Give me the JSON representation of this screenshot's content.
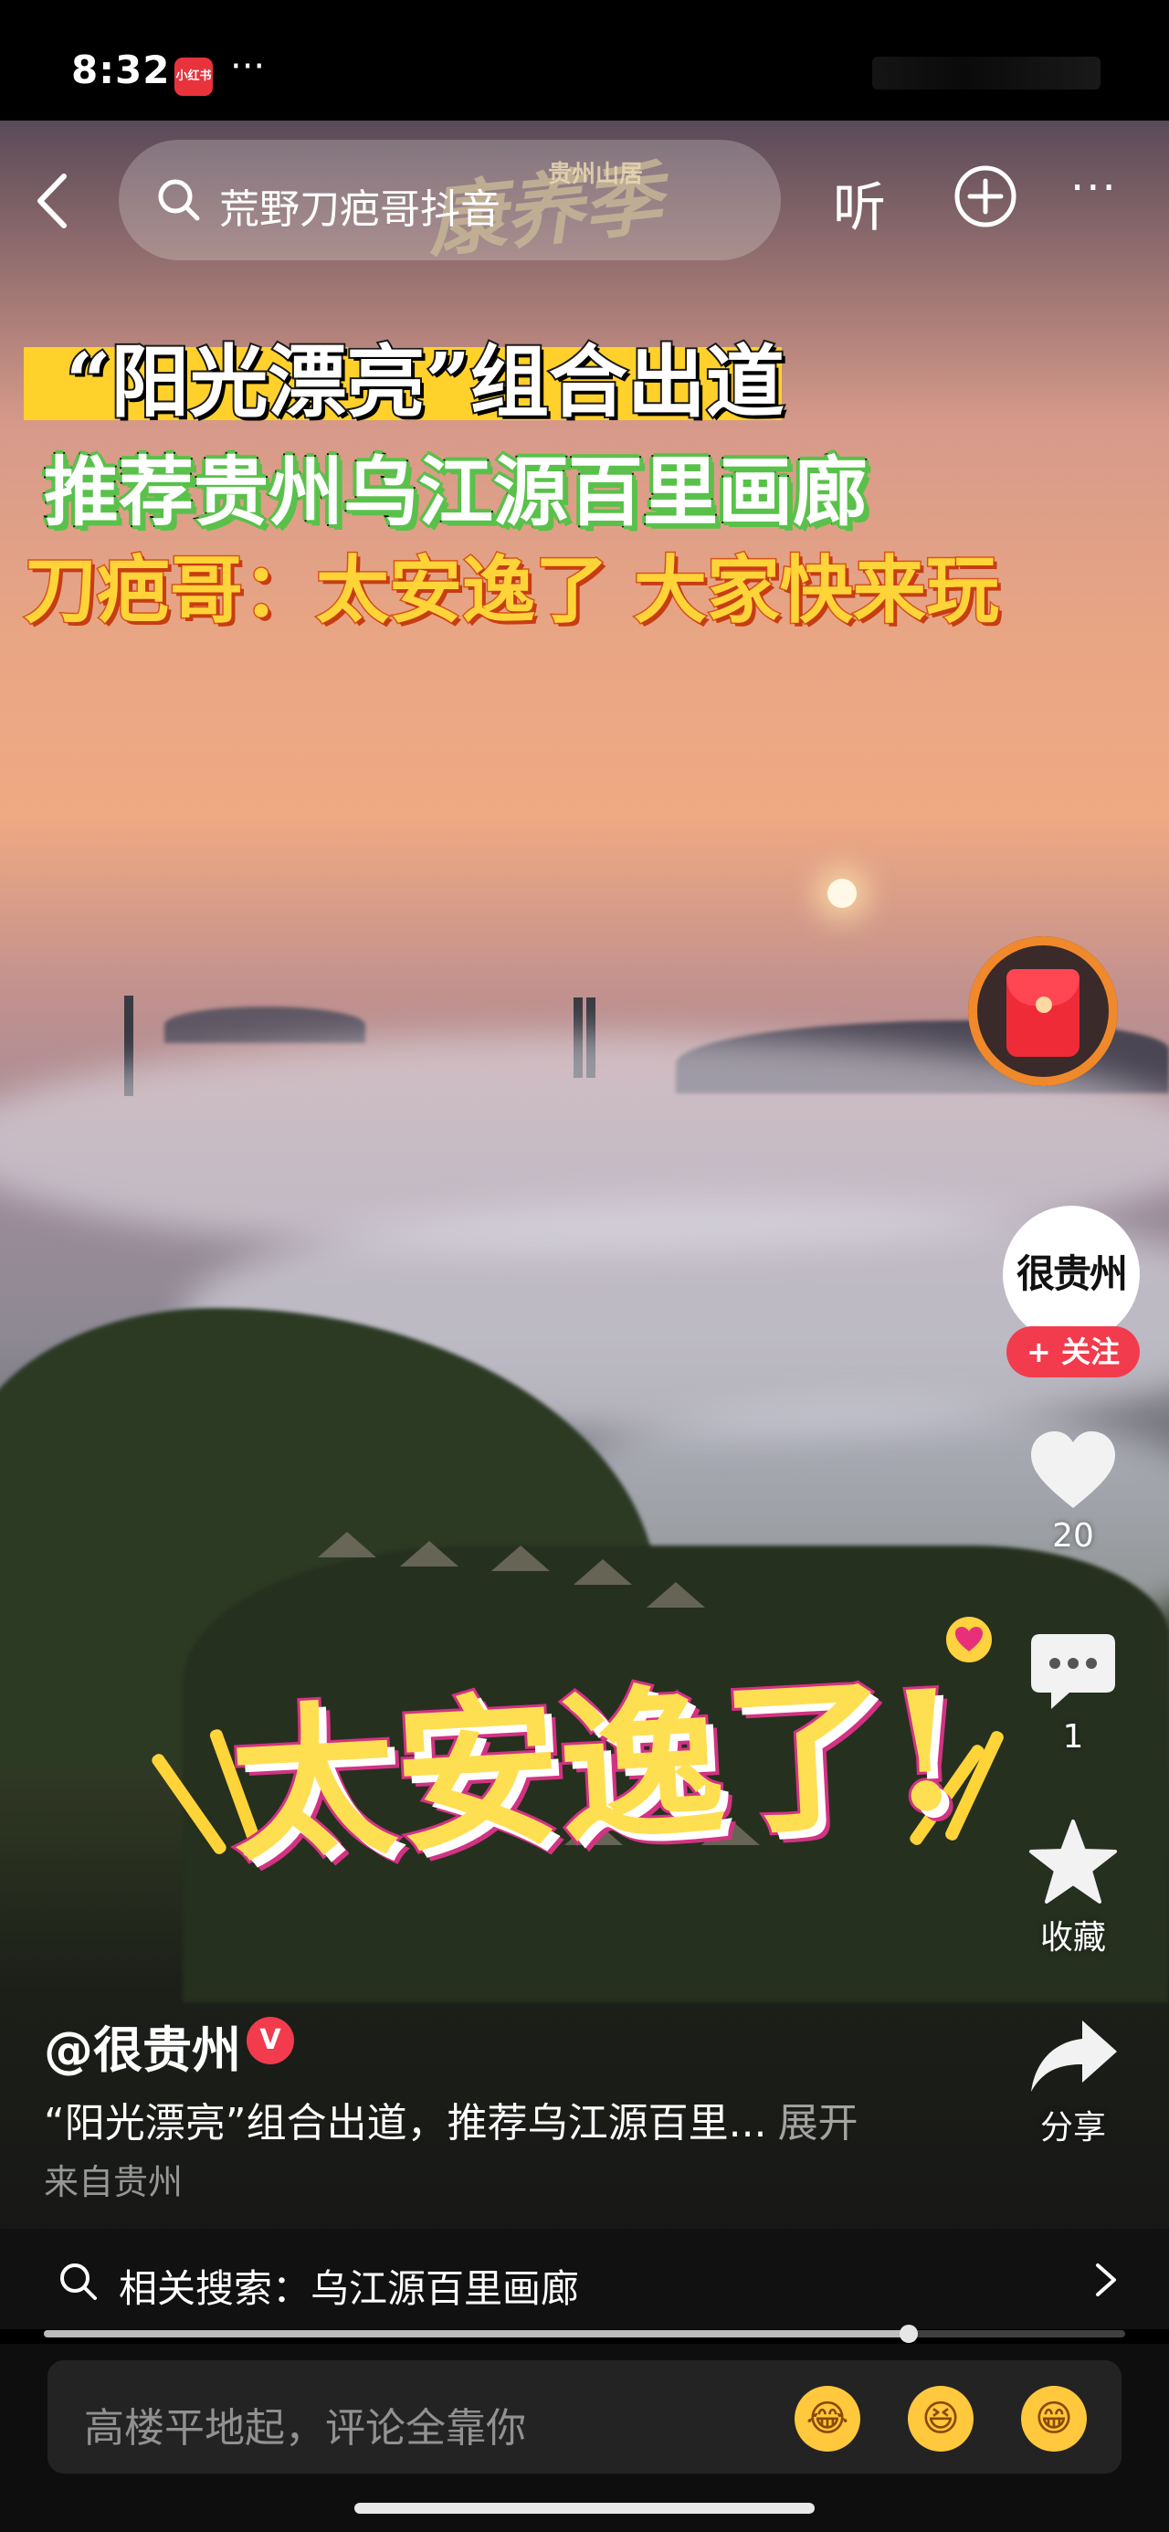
{
  "status_bar": {
    "time": "8:32",
    "app_badge": "小红书",
    "more": "···"
  },
  "top_bar": {
    "search_text": "荒野刀疤哥抖音",
    "listen_label": "听",
    "more_label": "···"
  },
  "watermark": {
    "main": "康养季",
    "small": "贵州山居"
  },
  "captions": {
    "line1": "“阳光漂亮”组合出道",
    "line2": "推荐贵州乌江源百里画廊",
    "line3": "刀疤哥：太安逸了 大家快来玩",
    "sticker": "太安逸了!"
  },
  "right_rail": {
    "avatar_text": "很贵州",
    "follow_label": "+ 关注",
    "like_count": "20",
    "comment_count": "1",
    "favorite_label": "收藏",
    "share_label": "分享"
  },
  "info": {
    "author": "@很贵州",
    "verified_badge": "V",
    "description": "“阳光漂亮”组合出道，推荐乌江源百里...",
    "expand_label": "展开",
    "location": "来自贵州"
  },
  "related_search": {
    "label": "相关搜索：乌江源百里画廊"
  },
  "progress": {
    "fraction": 0.8
  },
  "comment_bar": {
    "placeholder": "高楼平地起，评论全靠你",
    "emojis": [
      "😂",
      "😆",
      "😁"
    ]
  }
}
